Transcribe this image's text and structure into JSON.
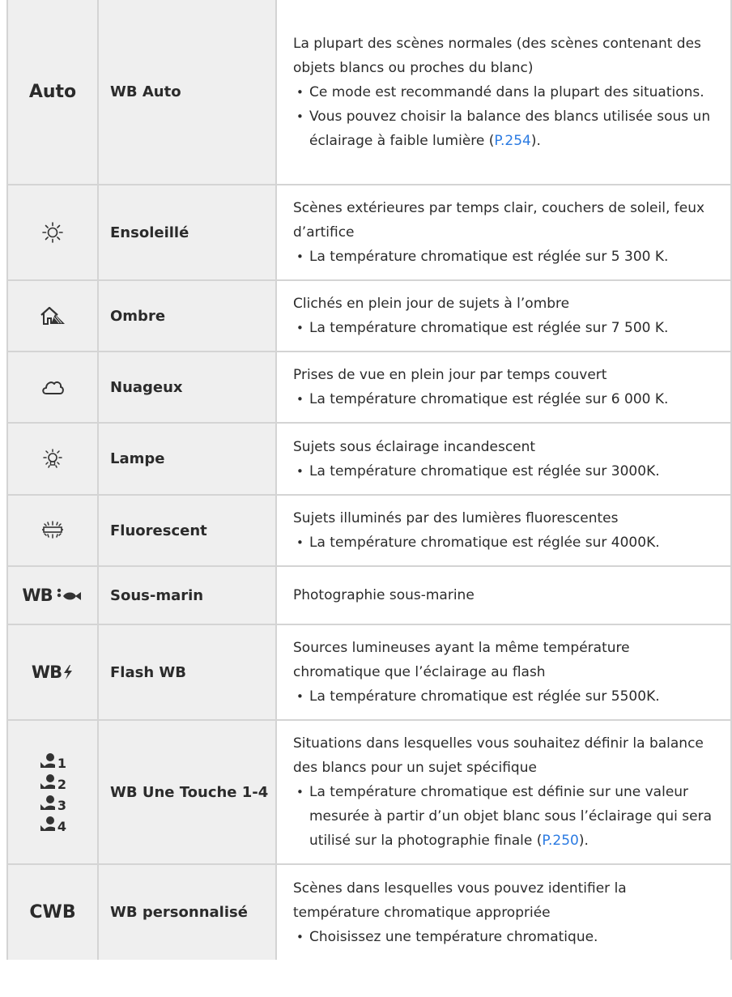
{
  "rows": [
    {
      "mode": "Auto",
      "name": "WB Auto",
      "desc": "La plupart des scènes normales (des scènes contenant des objets blancs ou proches du blanc)",
      "bullets": [
        "Ce mode est recommandé dans la plupart des situations.",
        {
          "before": "Vous pouvez choisir la balance des blancs utilisée sous un éclairage à faible lumière (",
          "link": "P.254",
          "after": ")."
        }
      ]
    },
    {
      "icon": "sun-icon",
      "name": "Ensoleillé",
      "desc": "Scènes extérieures par temps clair, couchers de soleil, feux d’artifice",
      "bullets": [
        "La température chromatique est réglée sur 5 300 K."
      ]
    },
    {
      "icon": "shade-icon",
      "name": "Ombre",
      "desc": "Clichés en plein jour de sujets à l’ombre",
      "bullets": [
        "La température chromatique est réglée sur 7 500 K."
      ]
    },
    {
      "icon": "cloud-icon",
      "name": "Nuageux",
      "desc": "Prises de vue en plein jour par temps couvert",
      "bullets": [
        "La température chromatique est réglée sur 6 000 K."
      ]
    },
    {
      "icon": "incandescent-lamp-icon",
      "name": "Lampe",
      "desc": "Sujets sous éclairage incandescent",
      "bullets": [
        "La température chromatique est réglée sur 3000K."
      ]
    },
    {
      "icon": "fluorescent-icon",
      "name": "Fluorescent",
      "desc": "Sujets illuminés par des lumières fluorescentes",
      "bullets": [
        "La température chromatique est réglée sur 4000K."
      ]
    },
    {
      "icon": "underwater-wb-icon",
      "mode": "WB",
      "name": "Sous-marin",
      "desc": "Photographie sous-marine",
      "bullets": []
    },
    {
      "icon": "flash-wb-icon",
      "mode": "WB",
      "name": "Flash WB",
      "desc": "Sources lumineuses ayant la même température chromatique que l’éclairage au flash",
      "bullets": [
        "La température chromatique est réglée sur 5500K."
      ]
    },
    {
      "icon": "one-touch-wb-icon",
      "subs": [
        "1",
        "2",
        "3",
        "4"
      ],
      "name": "WB Une Touche 1-4",
      "desc": "Situations dans lesquelles vous souhaitez définir la balance des blancs pour un sujet spécifique",
      "bullets": [
        {
          "before": "La température chromatique est définie sur une valeur mesurée à partir d’un objet blanc sous l’éclairage qui sera utilisé sur la photographie finale (",
          "link": "P.250",
          "after": ")."
        }
      ]
    },
    {
      "mode": "CWB",
      "name": "WB personnalisé",
      "desc": "Scènes dans lesquelles vous pouvez identifier la température chromatique appropriée",
      "bullets": [
        "Choisissez une température chromatique."
      ]
    }
  ]
}
